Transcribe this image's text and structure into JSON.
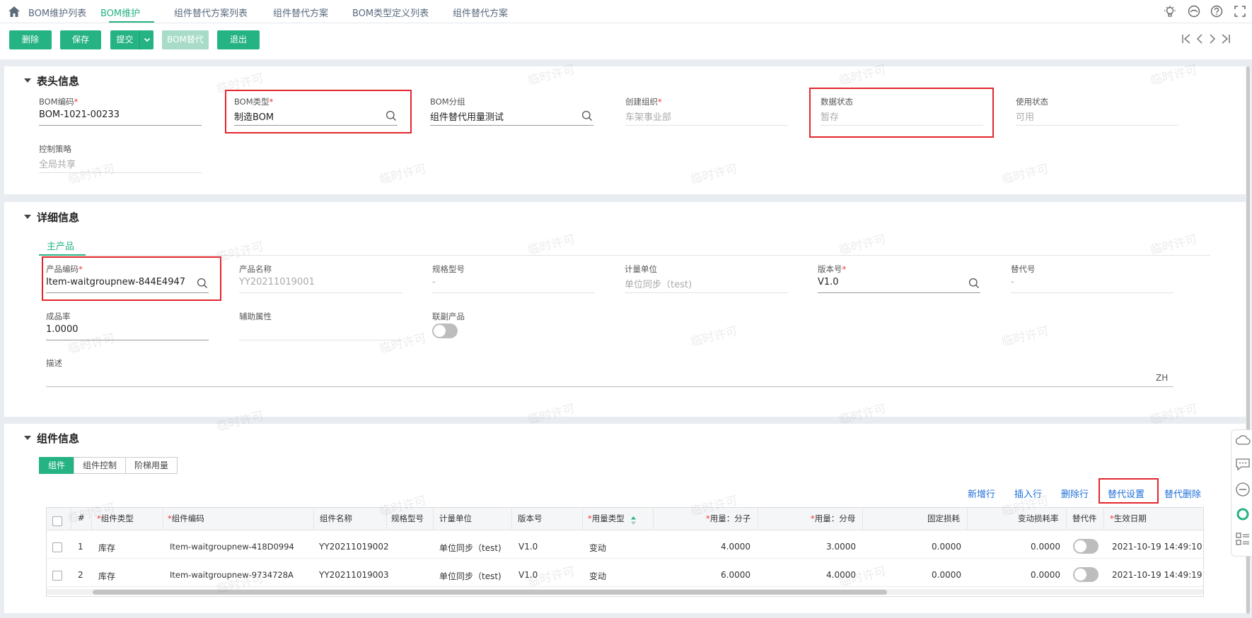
{
  "tabs": [
    "BOM维护列表",
    "BOM维护",
    "组件替代方案列表",
    "组件替代方案",
    "BOM类型定义列表",
    "组件替代方案"
  ],
  "toolbar": {
    "delete": "删除",
    "save": "保存",
    "submit": "提交",
    "bom_sub": "BOM替代",
    "exit": "退出"
  },
  "watermark": "临时许可",
  "header": {
    "title": "表头信息",
    "fields": [
      {
        "label": "BOM编码",
        "required": "*",
        "value": "BOM-1021-00233"
      },
      {
        "label": "BOM类型",
        "required": "*",
        "value": "制造BOM"
      },
      {
        "label": "BOM分组",
        "required": "",
        "value": "组件替代用量测试"
      },
      {
        "label": "创建组织",
        "required": "*",
        "value": "车架事业部"
      },
      {
        "label": "数据状态",
        "required": "",
        "value": "暂存"
      },
      {
        "label": "使用状态",
        "required": "",
        "value": "可用"
      },
      {
        "label": "控制策略",
        "required": "",
        "value": "全局共享"
      }
    ]
  },
  "detail": {
    "title": "详细信息",
    "tab": "主产品",
    "fields": [
      {
        "label": "产品编码",
        "required": "*",
        "value": "Item-waitgroupnew-844E4947"
      },
      {
        "label": "产品名称",
        "required": "",
        "value": "YY20211019001"
      },
      {
        "label": "规格型号",
        "required": "",
        "value": "-"
      },
      {
        "label": "计量单位",
        "required": "",
        "value": "单位同步（test)"
      },
      {
        "label": "版本号",
        "required": "*",
        "value": "V1.0"
      },
      {
        "label": "替代号",
        "required": "",
        "value": "-"
      },
      {
        "label": "成品率",
        "required": "",
        "value": "1.0000"
      },
      {
        "label": "辅助属性",
        "required": "",
        "value": ""
      },
      {
        "label": "联副产品",
        "required": "",
        "value": ""
      },
      {
        "label": "描述",
        "required": "",
        "value": ""
      }
    ],
    "lang": "ZH"
  },
  "components": {
    "title": "组件信息",
    "tabs": [
      "组件",
      "组件控制",
      "阶梯用量"
    ],
    "actions": [
      "新增行",
      "插入行",
      "删除行",
      "替代设置",
      "替代删除"
    ],
    "columns": [
      "#",
      "组件类型",
      "组件编码",
      "组件名称",
      "规格型号",
      "计量单位",
      "版本号",
      "用量类型",
      "用量：分子",
      "用量：分母",
      "固定损耗",
      "变动损耗率",
      "替代件",
      "生效日期"
    ],
    "required_mark": "*",
    "rows": [
      {
        "no": "1",
        "type": "库存",
        "code": "Item-waitgroupnew-418D0994",
        "name": "YY20211019002",
        "spec": "",
        "unit": "单位同步（test)",
        "ver": "V1.0",
        "usage": "变动",
        "num": "4.0000",
        "den": "3.0000",
        "fixed": "0.0000",
        "var": "0.0000",
        "date": "2021-10-19 14:49:10"
      },
      {
        "no": "2",
        "type": "库存",
        "code": "Item-waitgroupnew-9734728A",
        "name": "YY20211019003",
        "spec": "",
        "unit": "单位同步（test)",
        "ver": "V1.0",
        "usage": "变动",
        "num": "6.0000",
        "den": "4.0000",
        "fixed": "0.0000",
        "var": "0.0000",
        "date": "2021-10-19 14:49:19"
      }
    ]
  },
  "colors": {
    "primary": "#26b383",
    "link": "#1e6fd9",
    "highlight": "#e4252c"
  }
}
